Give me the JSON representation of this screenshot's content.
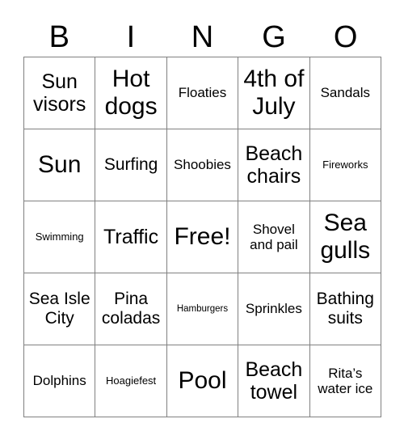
{
  "card": {
    "title_letters": [
      "B",
      "I",
      "N",
      "G",
      "O"
    ],
    "columns": 5,
    "rows": 5,
    "border_color": "#808080",
    "background_color": "#ffffff",
    "text_color": "#000000",
    "cells": [
      [
        {
          "label": "Sun visors",
          "size": "lg"
        },
        {
          "label": "Hot dogs",
          "size": "xl"
        },
        {
          "label": "Floaties",
          "size": "sm"
        },
        {
          "label": "4th of July",
          "size": "xl"
        },
        {
          "label": "Sandals",
          "size": "sm"
        }
      ],
      [
        {
          "label": "Sun",
          "size": "xl"
        },
        {
          "label": "Surfing",
          "size": "md"
        },
        {
          "label": "Shoobies",
          "size": "sm"
        },
        {
          "label": "Beach chairs",
          "size": "lg"
        },
        {
          "label": "Fireworks",
          "size": "xs"
        }
      ],
      [
        {
          "label": "Swimming",
          "size": "xs"
        },
        {
          "label": "Traffic",
          "size": "lg"
        },
        {
          "label": "Free!",
          "size": "xl"
        },
        {
          "label": "Shovel and pail",
          "size": "sm"
        },
        {
          "label": "Sea gulls",
          "size": "xl"
        }
      ],
      [
        {
          "label": "Sea Isle City",
          "size": "md"
        },
        {
          "label": "Pina coladas",
          "size": "md"
        },
        {
          "label": "Hamburgers",
          "size": "xxs"
        },
        {
          "label": "Sprinkles",
          "size": "sm"
        },
        {
          "label": "Bathing suits",
          "size": "md"
        }
      ],
      [
        {
          "label": "Dolphins",
          "size": "sm"
        },
        {
          "label": "Hoagiefest",
          "size": "xs"
        },
        {
          "label": "Pool",
          "size": "xl"
        },
        {
          "label": "Beach towel",
          "size": "lg"
        },
        {
          "label": "Rita’s water ice",
          "size": "sm"
        }
      ]
    ]
  }
}
